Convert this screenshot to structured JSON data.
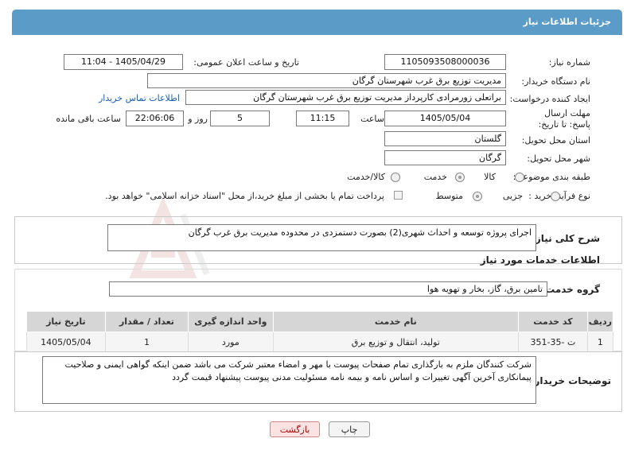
{
  "header": {
    "title": "جزئیات اطلاعات نیاز"
  },
  "form": {
    "need_number_label": "شماره نیاز:",
    "need_number": "1105093508000036",
    "announce_label": "تاریخ و ساعت اعلان عمومی:",
    "announce_value": "1405/04/29 - 11:04",
    "buyer_org_label": "نام دستگاه خریدار:",
    "buyer_org": "مدیریت توزیع برق غرب شهرستان گرگان",
    "creator_label": "ایجاد کننده درخواست:",
    "creator": "براتعلی زورمرادی کارپرداز مدیریت توزیع برق غرب شهرستان گرگان",
    "contact_link": "اطلاعات تماس خریدار",
    "deadline_label": "مهلت ارسال پاسخ: تا تاریخ:",
    "deadline_date": "1405/05/04",
    "time_label": "ساعت",
    "deadline_time": "11:15",
    "days_value": "5",
    "days_label": "روز و",
    "remaining_time": "22:06:06",
    "remaining_label": "ساعت باقی مانده",
    "province_label": "استان محل تحویل:",
    "province": "گلستان",
    "city_label": "شهر محل تحویل:",
    "city": "گرگان",
    "category_label": "طبقه بندی موضوعی:",
    "category_options": [
      "کالا",
      "خدمت",
      "کالا/خدمت"
    ],
    "process_label": "نوع فرآیند خرید :",
    "process_options": [
      "جزیی",
      "متوسط"
    ],
    "payment_note": "پرداخت تمام یا بخشی از مبلغ خرید،از محل \"اسناد خزانه اسلامی\" خواهد بود."
  },
  "summary": {
    "label": "شرح کلی نیاز:",
    "text": "اجرای پروژه توسعه و احداث شهری(2) بصورت دستمزدی در محدوده مدیریت برق غرب گرگان"
  },
  "services": {
    "title": "اطلاعات خدمات مورد نیاز",
    "group_label": "گروه خدمت:",
    "group_value": "تامین برق، گاز، بخار و تهویه هوا",
    "columns": [
      "ردیف",
      "کد خدمت",
      "نام خدمت",
      "واحد اندازه گیری",
      "تعداد / مقدار",
      "تاریخ نیاز"
    ],
    "rows": [
      [
        "1",
        "ت -35-351",
        "تولید، انتقال و توزیع برق",
        "مورد",
        "1",
        "1405/05/04"
      ]
    ]
  },
  "notes": {
    "label": "توضیحات خریدار:",
    "text": "شرکت کنندگان ملزم به بارگذاری تمام صفحات پیوست با مهر و امضاء معتبر شرکت می باشد ضمن اینکه گواهی ایمنی و صلاحیت پیمانکاری آخرین آگهی تغییرات و اساس نامه و بیمه نامه مسئولیت مدنی پیوست پیشنهاد قیمت گردد"
  },
  "buttons": {
    "print": "چاپ",
    "back": "بازگشت"
  }
}
